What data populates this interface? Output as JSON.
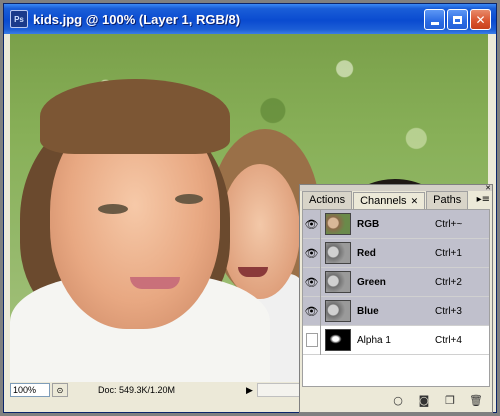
{
  "window": {
    "title": "kids.jpg @ 100% (Layer 1, RGB/8)",
    "app_icon": "Ps",
    "buttons": [
      "minimize",
      "maximize",
      "close"
    ]
  },
  "status": {
    "zoom": "100%",
    "doc_info": "Doc: 549.3K/1.20M"
  },
  "panel": {
    "tabs": [
      {
        "label": "Actions",
        "active": false
      },
      {
        "label": "Channels",
        "active": true
      },
      {
        "label": "Paths",
        "active": false
      }
    ],
    "channels": [
      {
        "name": "RGB",
        "shortcut": "Ctrl+~",
        "visible": true,
        "selected": true
      },
      {
        "name": "Red",
        "shortcut": "Ctrl+1",
        "visible": true,
        "selected": true
      },
      {
        "name": "Green",
        "shortcut": "Ctrl+2",
        "visible": true,
        "selected": true
      },
      {
        "name": "Blue",
        "shortcut": "Ctrl+3",
        "visible": true,
        "selected": true
      },
      {
        "name": "Alpha 1",
        "shortcut": "Ctrl+4",
        "visible": false,
        "selected": false
      }
    ],
    "footer_icons": [
      "load-selection-icon",
      "save-selection-icon",
      "new-channel-icon",
      "trash-icon"
    ]
  },
  "colors": {
    "titlebar": "#0a4bd0",
    "selected_row": "#c0c0cc"
  }
}
